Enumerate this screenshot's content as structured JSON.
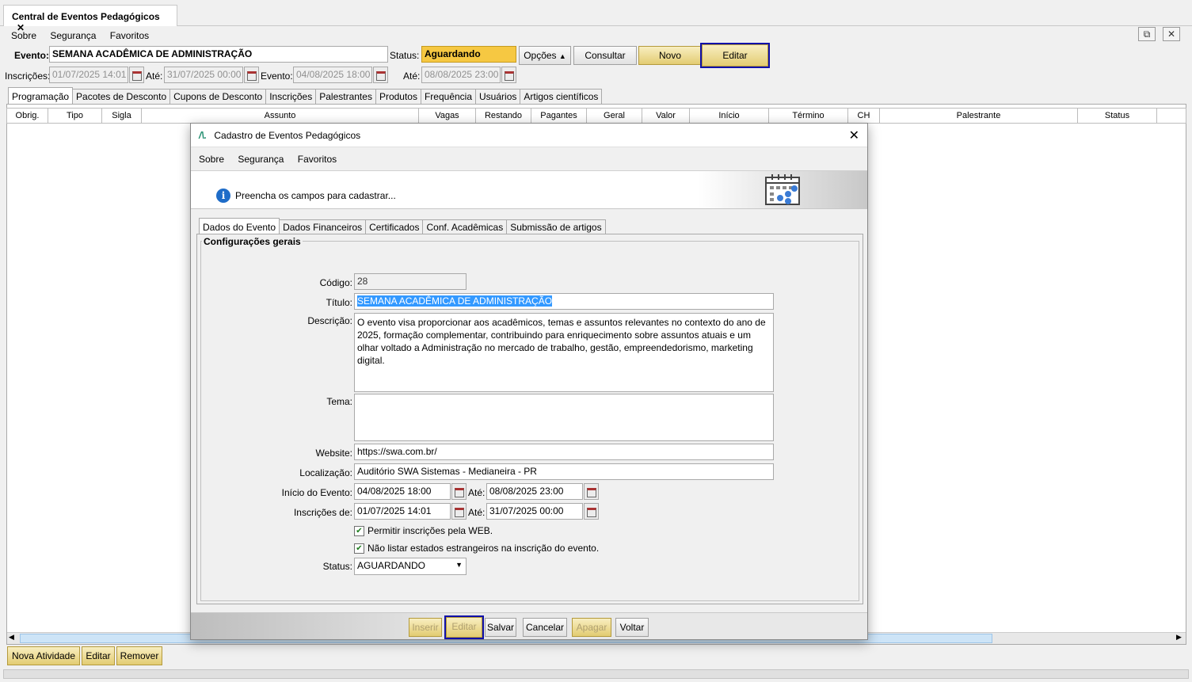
{
  "doc_tab": {
    "title": "Central de Eventos Pedagógicos",
    "close": "✕"
  },
  "menu": [
    "Sobre",
    "Segurança",
    "Favoritos"
  ],
  "window_buttons": {
    "detach": "⧉",
    "close": "✕"
  },
  "header": {
    "evento_label": "Evento:",
    "evento_value": "SEMANA ACADÊMICA DE ADMINISTRAÇÃO",
    "status_label": "Status:",
    "status_value": "Aguardando",
    "opcoes_label": "Opções",
    "consultar_label": "Consultar",
    "novo_label": "Novo",
    "editar_label": "Editar",
    "inscricoes_label": "Inscrições:",
    "inscricoes_de": "01/07/2025 14:01",
    "ate_label": "Até:",
    "inscricoes_ate": "31/07/2025 00:00",
    "evento_data_label": "Evento:",
    "evento_de": "04/08/2025 18:00",
    "ate2_label": "Até:",
    "evento_ate": "08/08/2025 23:00"
  },
  "main_tabs": [
    "Programação",
    "Pacotes de Desconto",
    "Cupons de Desconto",
    "Inscrições",
    "Palestrantes",
    "Produtos",
    "Frequência",
    "Usuários",
    "Artigos científicos"
  ],
  "grid_columns": [
    "Obrig.",
    "Tipo",
    "Sigla",
    "Assunto",
    "Vagas",
    "Restando",
    "Pagantes",
    "Geral",
    "Valor",
    "Início",
    "Término",
    "CH",
    "Palestrante",
    "Status"
  ],
  "bottom_buttons": {
    "nova": "Nova Atividade",
    "editar": "Editar",
    "remover": "Remover"
  },
  "dialog": {
    "title": "Cadastro de Eventos Pedagógicos",
    "menu": [
      "Sobre",
      "Segurança",
      "Favoritos"
    ],
    "info": "Preencha os campos para cadastrar...",
    "tabs": [
      "Dados do Evento",
      "Dados Financeiros",
      "Certificados",
      "Conf. Acadêmicas",
      "Submissão de artigos"
    ],
    "group_title": "Configurações gerais",
    "fields": {
      "codigo_label": "Código:",
      "codigo": "28",
      "titulo_label": "Título:",
      "titulo": "SEMANA ACADÊMICA DE ADMINISTRAÇÃO",
      "descricao_label": "Descrição:",
      "descricao": "O evento visa proporcionar aos acadêmicos, temas e assuntos relevantes no contexto do ano de 2025, formação complementar, contribuindo para enriquecimento sobre assuntos atuais e um olhar voltado a Administração no mercado de trabalho, gestão, empreendedorismo, marketing digital.",
      "tema_label": "Tema:",
      "tema": "",
      "website_label": "Website:",
      "website": "https://swa.com.br/",
      "localizacao_label": "Localização:",
      "localizacao": "Auditório SWA Sistemas - Medianeira - PR",
      "inicio_label": "Início do Evento:",
      "inicio": "04/08/2025 18:00",
      "ate_label": "Até:",
      "fim": "08/08/2025 23:00",
      "inscricoes_label": "Inscrições de:",
      "insc_inicio": "01/07/2025 14:01",
      "ate2_label": "Até:",
      "insc_fim": "31/07/2025 00:00",
      "check_web": "Permitir inscrições pela WEB.",
      "check_estrangeiros": "Não listar estados estrangeiros na inscrição do evento.",
      "status_label": "Status:",
      "status": "AGUARDANDO"
    },
    "footer_buttons": {
      "inserir": "Inserir",
      "editar": "Editar",
      "salvar": "Salvar",
      "cancelar": "Cancelar",
      "apagar": "Apagar",
      "voltar": "Voltar"
    }
  }
}
